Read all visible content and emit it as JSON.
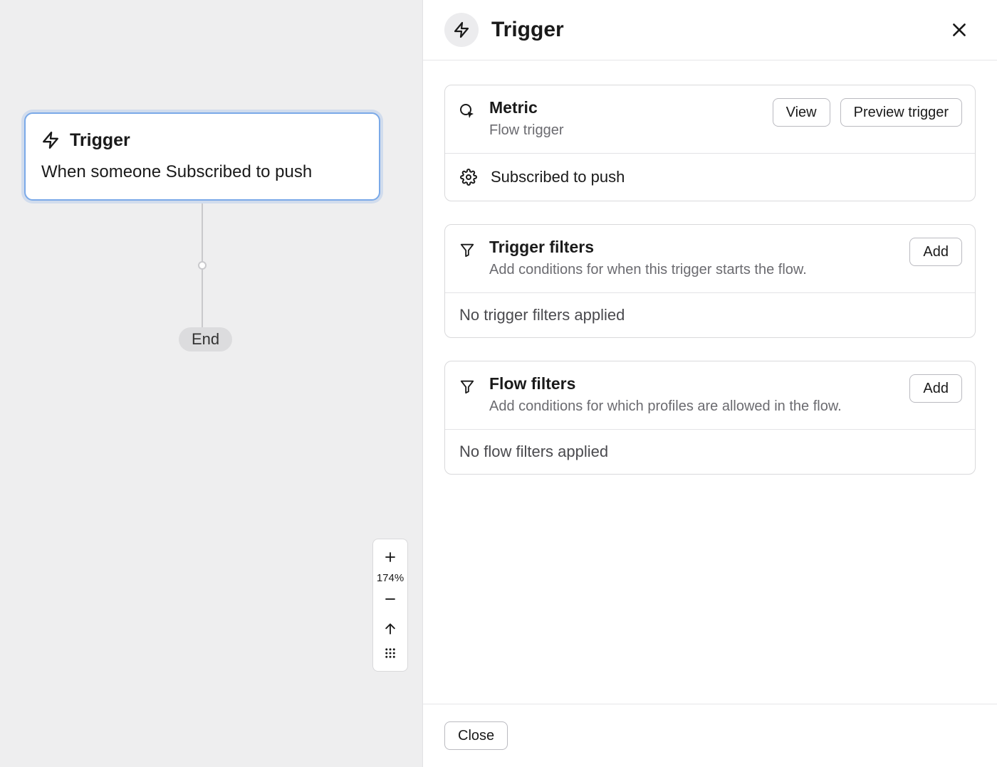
{
  "canvas": {
    "trigger_node": {
      "title": "Trigger",
      "body": "When someone Subscribed to push"
    },
    "end_label": "End",
    "zoom_level": "174%"
  },
  "panel": {
    "title": "Trigger",
    "metric": {
      "title": "Metric",
      "subtitle": "Flow trigger",
      "view_label": "View",
      "preview_label": "Preview trigger",
      "event": "Subscribed to push"
    },
    "trigger_filters": {
      "title": "Trigger filters",
      "subtitle": "Add conditions for when this trigger starts the flow.",
      "add_label": "Add",
      "status": "No trigger filters applied"
    },
    "flow_filters": {
      "title": "Flow filters",
      "subtitle": "Add conditions for which profiles are allowed in the flow.",
      "add_label": "Add",
      "status": "No flow filters applied"
    },
    "close_label": "Close"
  }
}
